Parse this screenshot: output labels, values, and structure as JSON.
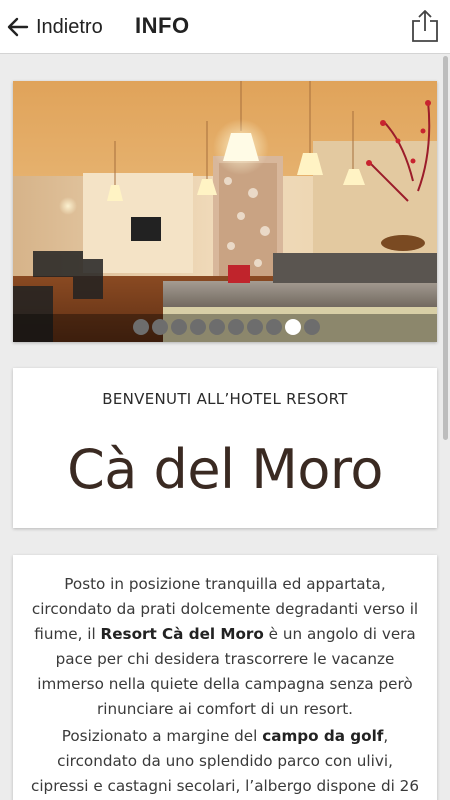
{
  "header": {
    "back_label": "Indietro",
    "title": "INFO"
  },
  "gallery": {
    "image_count": 10,
    "active_index": 8
  },
  "welcome": {
    "subtitle": "BENVENUTI ALL’HOTEL RESORT",
    "hotel_name": "Cà del Moro"
  },
  "description": {
    "p1_before": "Posto in posizione tranquilla ed appartata, circondato da prati dolcemente degradanti verso il fiume, il ",
    "p1_bold": "Resort Cà del Moro",
    "p1_after": " è un angolo di vera pace per chi desidera trascorrere le vacanze immerso nella quiete della campagna senza però rinunciare ai comfort di un resort.",
    "p2_before": "Posizionato a margine del ",
    "p2_bold": "campo da golf",
    "p2_after": ", circondato da uno splendido parco con ulivi, cipressi e castagni secolari, l’albergo dispone di 26"
  },
  "icons": {
    "back": "arrow-left-icon",
    "share": "share-icon"
  }
}
